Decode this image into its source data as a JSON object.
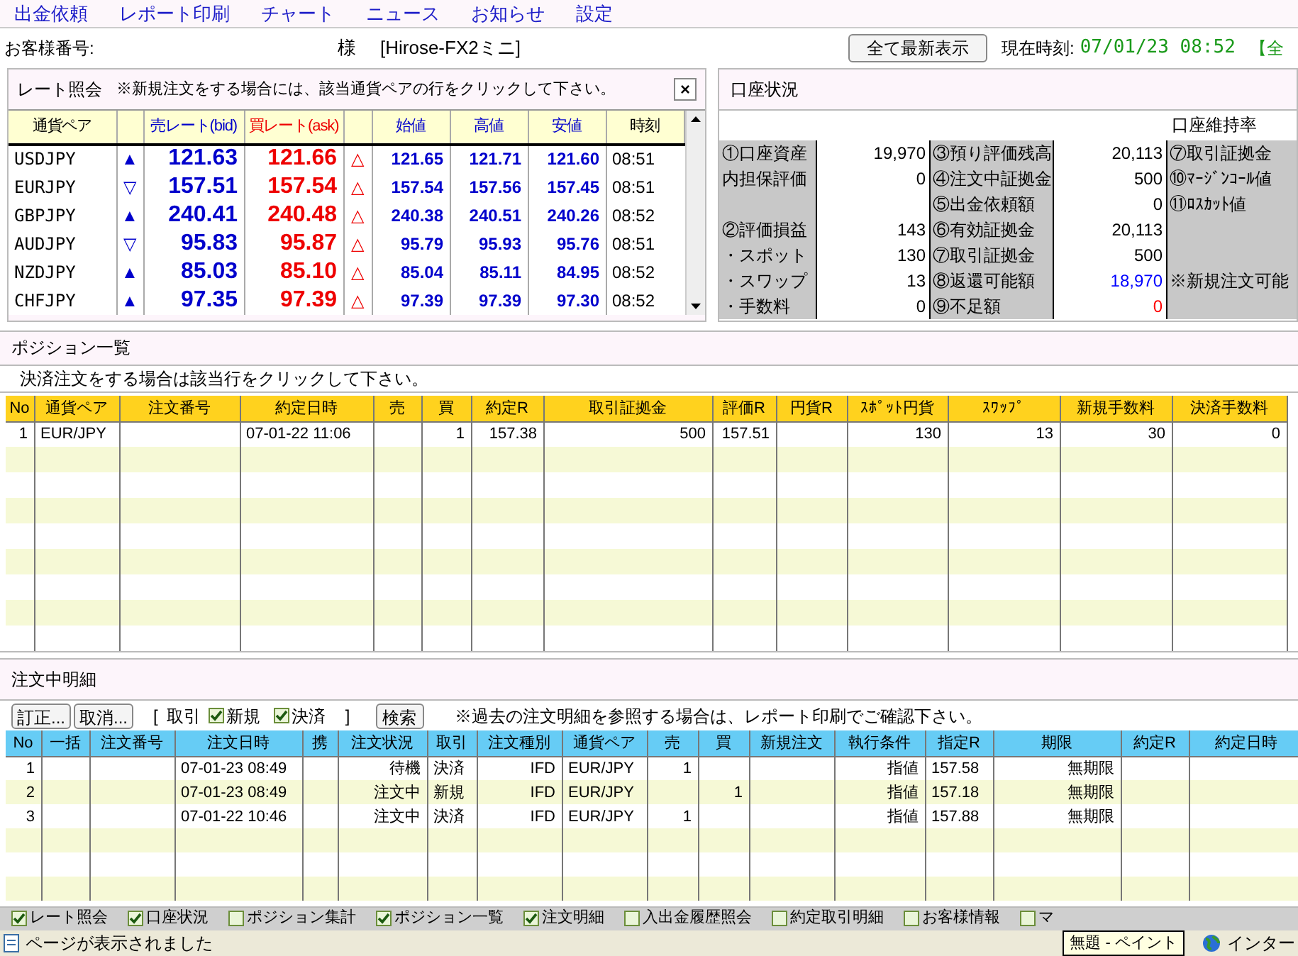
{
  "menu": [
    "出金依頼",
    "レポート印刷",
    "チャート",
    "ニュース",
    "お知らせ",
    "設定"
  ],
  "customer": {
    "label": "お客様番号:",
    "honorific": "様",
    "product": "[Hirose-FX2ミニ]",
    "refresh_button": "全て最新表示",
    "clock_label": "現在時刻:",
    "clock": "07/01/23 08:52",
    "cut_text": "【全"
  },
  "rates": {
    "title": "レート照会",
    "note": "※新規注文をする場合には、該当通貨ペアの行をクリックして下さい。",
    "close": "×",
    "columns": [
      "通貨ペア",
      "",
      "売レート(bid)",
      "買レート(ask)",
      "",
      "始値",
      "高値",
      "安値",
      "時刻"
    ],
    "rows": [
      {
        "pair": "USDJPY",
        "bid_mark": "▲",
        "bid": "121.63",
        "ask": "121.66",
        "ask_mark": "△",
        "open": "121.65",
        "high": "121.71",
        "low": "121.60",
        "time": "08:51"
      },
      {
        "pair": "EURJPY",
        "bid_mark": "▽",
        "bid": "157.51",
        "ask": "157.54",
        "ask_mark": "△",
        "open": "157.54",
        "high": "157.56",
        "low": "157.45",
        "time": "08:51"
      },
      {
        "pair": "GBPJPY",
        "bid_mark": "▲",
        "bid": "240.41",
        "ask": "240.48",
        "ask_mark": "△",
        "open": "240.38",
        "high": "240.51",
        "low": "240.26",
        "time": "08:52"
      },
      {
        "pair": "AUDJPY",
        "bid_mark": "▽",
        "bid": "95.83",
        "ask": "95.87",
        "ask_mark": "△",
        "open": "95.79",
        "high": "95.93",
        "low": "95.76",
        "time": "08:51"
      },
      {
        "pair": "NZDJPY",
        "bid_mark": "▲",
        "bid": "85.03",
        "ask": "85.10",
        "ask_mark": "△",
        "open": "85.04",
        "high": "85.11",
        "low": "84.95",
        "time": "08:52"
      },
      {
        "pair": "CHFJPY",
        "bid_mark": "▲",
        "bid": "97.35",
        "ask": "97.39",
        "ask_mark": "△",
        "open": "97.39",
        "high": "97.39",
        "low": "97.30",
        "time": "08:52"
      }
    ]
  },
  "account": {
    "title": "口座状況",
    "ratio_label": "口座維持率",
    "rows": [
      [
        {
          "label": "①口座資産"
        },
        {
          "value": "19,970"
        },
        {
          "label": "③預り評価残高"
        },
        {
          "value": "20,113"
        },
        {
          "label": "⑦取引証拠金"
        }
      ],
      [
        {
          "label": "内担保評価"
        },
        {
          "value": "0"
        },
        {
          "label": "④注文中証拠金"
        },
        {
          "value": "500"
        },
        {
          "label": "⑩ﾏｰｼﾞﾝｺｰﾙ値"
        }
      ],
      [
        {
          "kind": "label"
        },
        {
          "kind": "value"
        },
        {
          "label": "⑤出金依頼額"
        },
        {
          "value": "0"
        },
        {
          "label": "⑪ﾛｽｶｯﾄ値"
        }
      ],
      [
        {
          "label": "②評価損益"
        },
        {
          "value": "143"
        },
        {
          "label": "⑥有効証拠金"
        },
        {
          "value": "20,113"
        },
        {
          "kind": "label"
        }
      ],
      [
        {
          "label": "・スポット"
        },
        {
          "value": "130"
        },
        {
          "label": "⑦取引証拠金"
        },
        {
          "value": "500"
        },
        {
          "kind": "label"
        }
      ],
      [
        {
          "label": "・スワップ"
        },
        {
          "value": "13"
        },
        {
          "label": "⑧返還可能額"
        },
        {
          "value": "18,970",
          "color": "#0000ff"
        },
        {
          "label": "※新規注文可能"
        }
      ],
      [
        {
          "label": "・手数料"
        },
        {
          "value": "0"
        },
        {
          "label": "⑨不足額"
        },
        {
          "value": "0",
          "color": "#ff0000"
        },
        {
          "kind": "label"
        }
      ]
    ]
  },
  "positions": {
    "title": "ポジション一覧",
    "note": "決済注文をする場合は該当行をクリックして下さい。",
    "columns": [
      "No",
      "通貨ペア",
      "注文番号",
      "約定日時",
      "売",
      "買",
      "約定R",
      "取引証拠金",
      "評価R",
      "円貨R",
      "ｽﾎﾟｯﾄ円貨",
      "ｽﾜｯﾌﾟ",
      "新規手数料",
      "決済手数料"
    ],
    "rows": [
      [
        "1",
        "EUR/JPY",
        "",
        "07-01-22 11:06",
        "",
        "1",
        "157.38",
        "500",
        "157.51",
        "",
        "130",
        "13",
        "30",
        "0"
      ]
    ]
  },
  "orders": {
    "title": "注文中明細",
    "buttons": [
      "訂正...",
      "取消..."
    ],
    "filter_open": "[",
    "filter_label": "取引",
    "filters": [
      {
        "label": "新規",
        "checked": true
      },
      {
        "label": "決済",
        "checked": true
      }
    ],
    "filter_close": "]",
    "search_button": "検索",
    "note": "※過去の注文明細を参照する場合は、レポート印刷でご確認下さい。",
    "columns": [
      "No",
      "一括",
      "注文番号",
      "注文日時",
      "携",
      "注文状況",
      "取引",
      "注文種別",
      "通貨ペア",
      "売",
      "買",
      "新規注文",
      "執行条件",
      "指定R",
      "期限",
      "約定R",
      "約定日時"
    ],
    "rows": [
      [
        "1",
        "",
        "",
        "07-01-23 08:49",
        "",
        "待機",
        "決済",
        "IFD",
        "EUR/JPY",
        "1",
        "",
        "",
        "指値",
        "157.58",
        "無期限",
        "",
        ""
      ],
      [
        "2",
        "",
        "",
        "07-01-23 08:49",
        "",
        "注文中",
        "新規",
        "IFD",
        "EUR/JPY",
        "",
        "1",
        "",
        "指値",
        "157.18",
        "無期限",
        "",
        ""
      ],
      [
        "3",
        "",
        "",
        "07-01-22 10:46",
        "",
        "注文中",
        "決済",
        "IFD",
        "EUR/JPY",
        "1",
        "",
        "",
        "指値",
        "157.88",
        "無期限",
        "",
        ""
      ]
    ]
  },
  "panels": [
    {
      "label": "レート照会",
      "checked": true
    },
    {
      "label": "口座状況",
      "checked": true
    },
    {
      "label": "ポジション集計",
      "checked": false
    },
    {
      "label": "ポジション一覧",
      "checked": true
    },
    {
      "label": "注文明細",
      "checked": true
    },
    {
      "label": "入出金履歴照会",
      "checked": false
    },
    {
      "label": "約定取引明細",
      "checked": false
    },
    {
      "label": "お客様情報",
      "checked": false
    },
    {
      "label": "マ",
      "checked": false
    }
  ],
  "status_bar": {
    "message": "ページが表示されました",
    "popup": "無題 - ペイント",
    "zone": "インター"
  }
}
